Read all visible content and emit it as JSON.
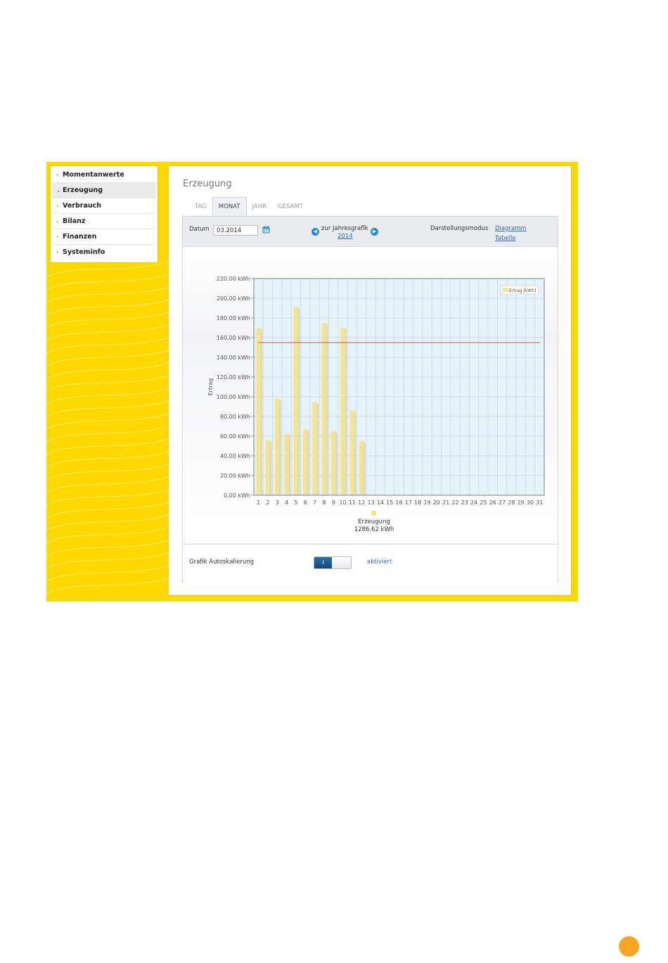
{
  "sidebar": {
    "items": [
      {
        "label": "Momentanwerte",
        "arrow": "›"
      },
      {
        "label": "Erzeugung",
        "arrow": "⌄"
      },
      {
        "label": "Verbrauch",
        "arrow": "›"
      },
      {
        "label": "Bilanz",
        "arrow": "›"
      },
      {
        "label": "Finanzen",
        "arrow": "›"
      },
      {
        "label": "Systeminfo",
        "arrow": "›"
      }
    ],
    "active": "Erzeugung"
  },
  "main": {
    "title": "Erzeugung",
    "tabs": [
      "TAG",
      "MONAT",
      "JAHR",
      "GESAMT"
    ],
    "active_tab": "MONAT"
  },
  "toolbar": {
    "date_label": "Datum",
    "date_value": "03.2014",
    "year_nav_text": "zur Jahresgrafik",
    "year_link": "2014",
    "mode_label": "Darstellungsmodus",
    "mode_diagram": "Diagramm",
    "mode_table": "Tabelle"
  },
  "footer": {
    "autoscale_label": "Grafik Autoskalierung",
    "toggle_value": "I",
    "status": "aktiviert"
  },
  "colors": {
    "frame": "#ffd800",
    "bar": "#f7e38a",
    "target_line": "#e8474f",
    "plot_bg": "#e7f3fb",
    "accent_blue": "#1a8fd6"
  },
  "chart_data": {
    "type": "bar",
    "ylabel": "Ertrag",
    "ylim": [
      0,
      220
    ],
    "y_ticks": [
      "0.00 kWh",
      "20.00 kWh",
      "40.00 kWh",
      "60.00 kWh",
      "80.00 kWh",
      "100.00 kWh",
      "120.00 kWh",
      "140.00 kWh",
      "160.00 kWh",
      "180.00 kWh",
      "200.00 kWh",
      "220.00 kWh"
    ],
    "categories": [
      "1",
      "2",
      "3",
      "4",
      "5",
      "6",
      "7",
      "8",
      "9",
      "10",
      "11",
      "12",
      "13",
      "14",
      "15",
      "16",
      "17",
      "18",
      "19",
      "20",
      "21",
      "22",
      "23",
      "24",
      "25",
      "26",
      "27",
      "28",
      "29",
      "30",
      "31"
    ],
    "series": [
      {
        "name": "Ertrag [kWh]",
        "values": [
          170,
          56,
          98,
          62,
          191,
          67,
          94,
          175,
          65,
          170,
          86,
          55,
          null,
          null,
          null,
          null,
          null,
          null,
          null,
          null,
          null,
          null,
          null,
          null,
          null,
          null,
          null,
          null,
          null,
          null,
          null
        ]
      }
    ],
    "target_value": 155,
    "legend_position": "top-right",
    "summary_label": "Erzeugung",
    "summary_value": "1286.62 kWh",
    "grid": true
  }
}
